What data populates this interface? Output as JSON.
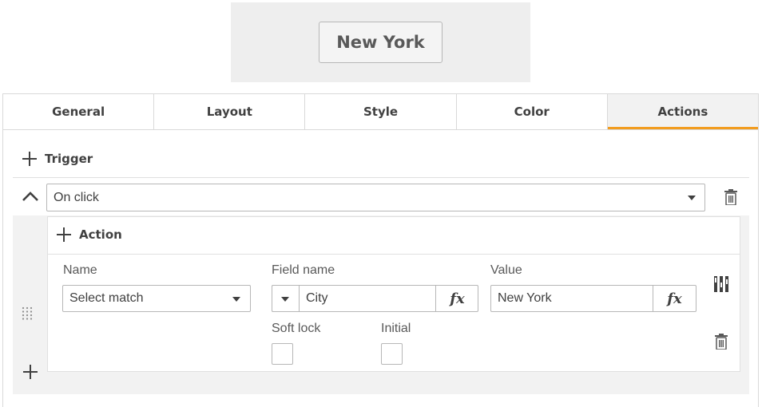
{
  "preview": {
    "button_label": "New York"
  },
  "tabs": [
    {
      "label": "General"
    },
    {
      "label": "Layout"
    },
    {
      "label": "Style"
    },
    {
      "label": "Color"
    },
    {
      "label": "Actions",
      "active": true
    }
  ],
  "trigger": {
    "add_label": "Trigger",
    "selected": "On click"
  },
  "action": {
    "add_label": "Action",
    "name": {
      "label": "Name",
      "value": "Select match"
    },
    "field_name": {
      "label": "Field name",
      "value": "City",
      "fx": "fx"
    },
    "value": {
      "label": "Value",
      "value": "New York",
      "fx": "fx"
    },
    "soft_lock": {
      "label": "Soft lock",
      "checked": false
    },
    "initial": {
      "label": "Initial",
      "checked": false
    }
  },
  "colors": {
    "accent": "#f29c1f",
    "panel_bg": "#f2f2f2",
    "border": "#b7b7b7"
  },
  "icons": [
    "plus-icon",
    "chevron-up-icon",
    "caret-down-icon",
    "trash-icon",
    "drag-handle-icon",
    "columns-icon"
  ]
}
